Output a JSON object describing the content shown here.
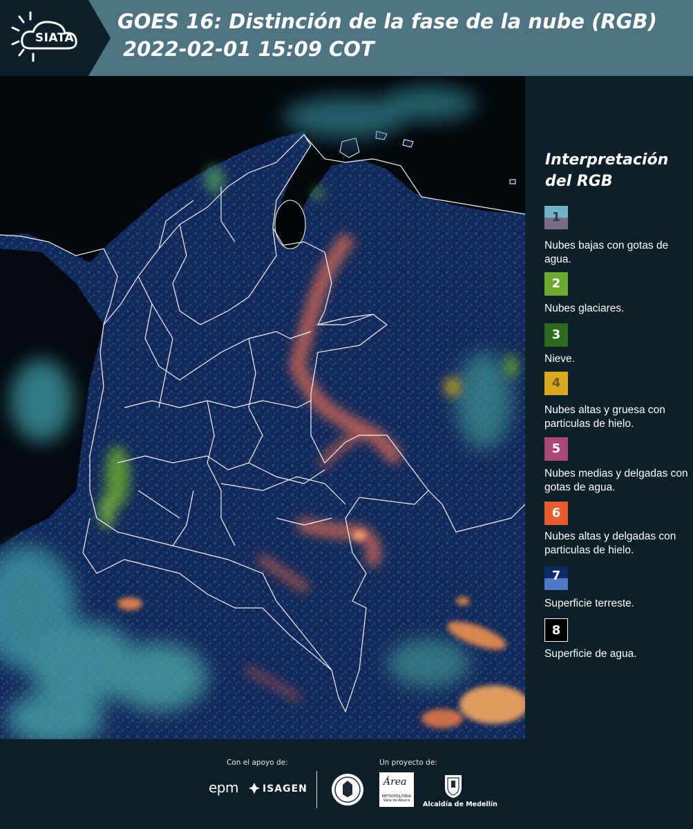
{
  "header": {
    "logo_text": "SIATA",
    "title_line1": "GOES 16: Distinción de la fase de la nube (RGB)",
    "title_line2": "2022-02-01 15:09 COT"
  },
  "legend": {
    "title": "Interpretación del RGB",
    "items": [
      {
        "number": "1",
        "label": "Nubes bajas con gotas de agua.",
        "colors": [
          "#6fb5c6",
          "#766d85"
        ]
      },
      {
        "number": "2",
        "label": "Nubes glaciares.",
        "colors": [
          "#6aaa2e"
        ]
      },
      {
        "number": "3",
        "label": "Nieve.",
        "colors": [
          "#2c6a1e"
        ]
      },
      {
        "number": "4",
        "label": "Nubes altas y gruesa con particulas de hielo.",
        "colors": [
          "#d9a81d"
        ]
      },
      {
        "number": "5",
        "label": "Nubes medias y delgadas con gotas de agua.",
        "colors": [
          "#a9477b"
        ]
      },
      {
        "number": "6",
        "label": "Nubes altas y delgadas con particulas de hielo.",
        "colors": [
          "#e85b2c"
        ]
      },
      {
        "number": "7",
        "label": "Superficie terreste.",
        "colors": [
          "#0c2a66",
          "#4f79c4"
        ]
      },
      {
        "number": "8",
        "label": "Superficie de agua.",
        "colors": [
          "#000000"
        ]
      }
    ]
  },
  "footer": {
    "support_caption": "Con el apoyo de:",
    "project_caption": "Un proyecto de:",
    "sponsor_epm": "epm",
    "sponsor_isagen": "ISAGEN",
    "area_logo_word": "Área",
    "area_logo_sub": "METROPOLITANA Valle de Aburrá",
    "alcaldia": "Alcaldía de Medellín"
  },
  "colors": {
    "header_bg": "#4f7481",
    "panel_bg": "#0d1f29",
    "land_surface": "#16336a",
    "water_surface": "#000000",
    "high_thin_ice_cloud": "#e85b2c",
    "low_water_cloud": "#4fa8b8"
  }
}
